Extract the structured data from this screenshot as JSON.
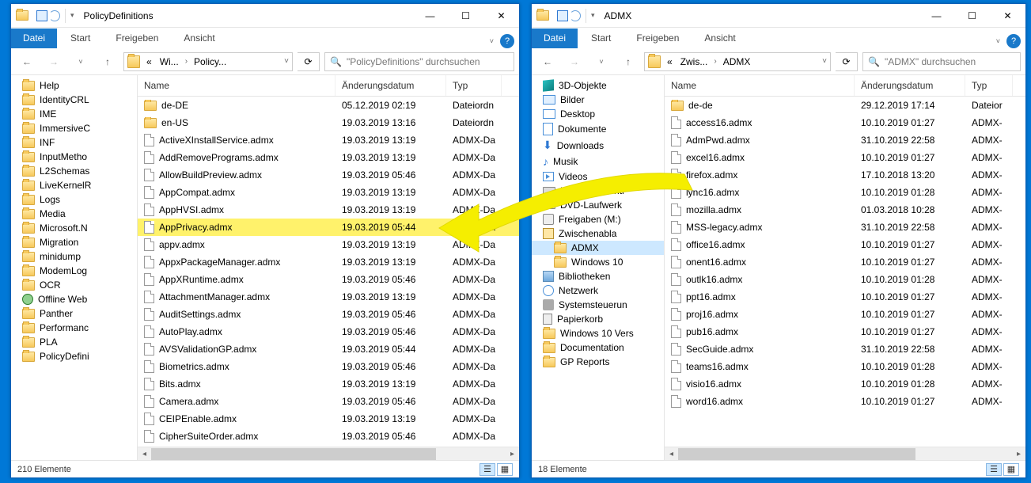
{
  "left": {
    "title": "PolicyDefinitions",
    "tabs": {
      "primary": "Datei",
      "items": [
        "Start",
        "Freigeben",
        "Ansicht"
      ]
    },
    "crumbs": [
      "«",
      "Wi...",
      "Policy..."
    ],
    "search_placeholder": "\"PolicyDefinitions\" durchsuchen",
    "columns": {
      "name": "Name",
      "date": "Änderungsdatum",
      "type": "Typ"
    },
    "colw": {
      "name": 250,
      "date": 140,
      "type": 70
    },
    "tree": [
      "Help",
      "IdentityCRL",
      "IME",
      "ImmersiveC",
      "INF",
      "InputMetho",
      "L2Schemas",
      "LiveKernelR",
      "Logs",
      "Media",
      "Microsoft.N",
      "Migration",
      "minidump",
      "ModemLog",
      "OCR",
      "Offline Web",
      "Panther",
      "Performanc",
      "PLA",
      "PolicyDefini"
    ],
    "tree_special_index": 15,
    "files": [
      {
        "icon": "folder",
        "name": "de-DE",
        "date": "05.12.2019 02:19",
        "type": "Dateiordn"
      },
      {
        "icon": "folder",
        "name": "en-US",
        "date": "19.03.2019 13:16",
        "type": "Dateiordn"
      },
      {
        "icon": "file",
        "name": "ActiveXInstallService.admx",
        "date": "19.03.2019 13:19",
        "type": "ADMX-Da"
      },
      {
        "icon": "file",
        "name": "AddRemovePrograms.admx",
        "date": "19.03.2019 13:19",
        "type": "ADMX-Da"
      },
      {
        "icon": "file",
        "name": "AllowBuildPreview.admx",
        "date": "19.03.2019 05:46",
        "type": "ADMX-Da"
      },
      {
        "icon": "file",
        "name": "AppCompat.admx",
        "date": "19.03.2019 13:19",
        "type": "ADMX-Da"
      },
      {
        "icon": "file",
        "name": "AppHVSI.admx",
        "date": "19.03.2019 13:19",
        "type": "ADMX-Da"
      },
      {
        "icon": "file",
        "name": "AppPrivacy.admx",
        "date": "19.03.2019 05:44",
        "type": "ADMX-Da",
        "hi": true
      },
      {
        "icon": "file",
        "name": "appv.admx",
        "date": "19.03.2019 13:19",
        "type": "ADMX-Da"
      },
      {
        "icon": "file",
        "name": "AppxPackageManager.admx",
        "date": "19.03.2019 13:19",
        "type": "ADMX-Da"
      },
      {
        "icon": "file",
        "name": "AppXRuntime.admx",
        "date": "19.03.2019 05:46",
        "type": "ADMX-Da"
      },
      {
        "icon": "file",
        "name": "AttachmentManager.admx",
        "date": "19.03.2019 13:19",
        "type": "ADMX-Da"
      },
      {
        "icon": "file",
        "name": "AuditSettings.admx",
        "date": "19.03.2019 05:46",
        "type": "ADMX-Da"
      },
      {
        "icon": "file",
        "name": "AutoPlay.admx",
        "date": "19.03.2019 05:46",
        "type": "ADMX-Da"
      },
      {
        "icon": "file",
        "name": "AVSValidationGP.admx",
        "date": "19.03.2019 05:44",
        "type": "ADMX-Da"
      },
      {
        "icon": "file",
        "name": "Biometrics.admx",
        "date": "19.03.2019 05:46",
        "type": "ADMX-Da"
      },
      {
        "icon": "file",
        "name": "Bits.admx",
        "date": "19.03.2019 13:19",
        "type": "ADMX-Da"
      },
      {
        "icon": "file",
        "name": "Camera.admx",
        "date": "19.03.2019 05:46",
        "type": "ADMX-Da"
      },
      {
        "icon": "file",
        "name": "CEIPEnable.admx",
        "date": "19.03.2019 13:19",
        "type": "ADMX-Da"
      },
      {
        "icon": "file",
        "name": "CipherSuiteOrder.admx",
        "date": "19.03.2019 05:46",
        "type": "ADMX-Da"
      }
    ],
    "status": "210 Elemente"
  },
  "right": {
    "title": "ADMX",
    "tabs": {
      "primary": "Datei",
      "items": [
        "Start",
        "Freigeben",
        "Ansicht"
      ]
    },
    "crumbs": [
      "«",
      "Zwis...",
      "ADMX"
    ],
    "search_placeholder": "\"ADMX\" durchsuchen",
    "columns": {
      "name": "Name",
      "date": "Änderungsdatum",
      "type": "Typ"
    },
    "colw": {
      "name": 240,
      "date": 140,
      "type": 60
    },
    "tree": [
      {
        "icon": "3d",
        "label": "3D-Objekte",
        "ind": 0
      },
      {
        "icon": "pic",
        "label": "Bilder",
        "ind": 0
      },
      {
        "icon": "desktop",
        "label": "Desktop",
        "ind": 0
      },
      {
        "icon": "doc",
        "label": "Dokumente",
        "ind": 0
      },
      {
        "icon": "down",
        "label": "Downloads",
        "ind": 0
      },
      {
        "icon": "music",
        "label": "Musik",
        "ind": 0
      },
      {
        "icon": "video",
        "label": "Videos",
        "ind": 0
      },
      {
        "icon": "drive",
        "label": "Lokaler Datentr",
        "ind": 0
      },
      {
        "icon": "drive",
        "label": "DVD-Laufwerk",
        "ind": 0
      },
      {
        "icon": "share",
        "label": "Freigaben (M:)",
        "ind": 0
      },
      {
        "icon": "box",
        "label": "Zwischenabla",
        "ind": 0
      },
      {
        "icon": "folder",
        "label": "ADMX",
        "ind": 1,
        "sel": true
      },
      {
        "icon": "folder",
        "label": "Windows 10",
        "ind": 1
      },
      {
        "icon": "lib",
        "label": "Bibliotheken",
        "ind": -1
      },
      {
        "icon": "net",
        "label": "Netzwerk",
        "ind": -1
      },
      {
        "icon": "sys",
        "label": "Systemsteuerun",
        "ind": -1
      },
      {
        "icon": "trash",
        "label": "Papierkorb",
        "ind": -1
      },
      {
        "icon": "folder",
        "label": "Windows 10 Vers",
        "ind": -1
      },
      {
        "icon": "folder",
        "label": "Documentation",
        "ind": 0
      },
      {
        "icon": "folder",
        "label": "GP Reports",
        "ind": 0
      }
    ],
    "files": [
      {
        "icon": "folder",
        "name": "de-de",
        "date": "29.12.2019 17:14",
        "type": "Dateior"
      },
      {
        "icon": "file",
        "name": "access16.admx",
        "date": "10.10.2019 01:27",
        "type": "ADMX-"
      },
      {
        "icon": "file",
        "name": "AdmPwd.admx",
        "date": "31.10.2019 22:58",
        "type": "ADMX-"
      },
      {
        "icon": "file",
        "name": "excel16.admx",
        "date": "10.10.2019 01:27",
        "type": "ADMX-"
      },
      {
        "icon": "file",
        "name": "firefox.admx",
        "date": "17.10.2018 13:20",
        "type": "ADMX-"
      },
      {
        "icon": "file",
        "name": "lync16.admx",
        "date": "10.10.2019 01:28",
        "type": "ADMX-"
      },
      {
        "icon": "file",
        "name": "mozilla.admx",
        "date": "01.03.2018 10:28",
        "type": "ADMX-"
      },
      {
        "icon": "file",
        "name": "MSS-legacy.admx",
        "date": "31.10.2019 22:58",
        "type": "ADMX-"
      },
      {
        "icon": "file",
        "name": "office16.admx",
        "date": "10.10.2019 01:27",
        "type": "ADMX-"
      },
      {
        "icon": "file",
        "name": "onent16.admx",
        "date": "10.10.2019 01:27",
        "type": "ADMX-"
      },
      {
        "icon": "file",
        "name": "outlk16.admx",
        "date": "10.10.2019 01:28",
        "type": "ADMX-"
      },
      {
        "icon": "file",
        "name": "ppt16.admx",
        "date": "10.10.2019 01:27",
        "type": "ADMX-"
      },
      {
        "icon": "file",
        "name": "proj16.admx",
        "date": "10.10.2019 01:27",
        "type": "ADMX-"
      },
      {
        "icon": "file",
        "name": "pub16.admx",
        "date": "10.10.2019 01:27",
        "type": "ADMX-"
      },
      {
        "icon": "file",
        "name": "SecGuide.admx",
        "date": "31.10.2019 22:58",
        "type": "ADMX-"
      },
      {
        "icon": "file",
        "name": "teams16.admx",
        "date": "10.10.2019 01:28",
        "type": "ADMX-"
      },
      {
        "icon": "file",
        "name": "visio16.admx",
        "date": "10.10.2019 01:28",
        "type": "ADMX-"
      },
      {
        "icon": "file",
        "name": "word16.admx",
        "date": "10.10.2019 01:27",
        "type": "ADMX-"
      }
    ],
    "status": "18 Elemente"
  }
}
